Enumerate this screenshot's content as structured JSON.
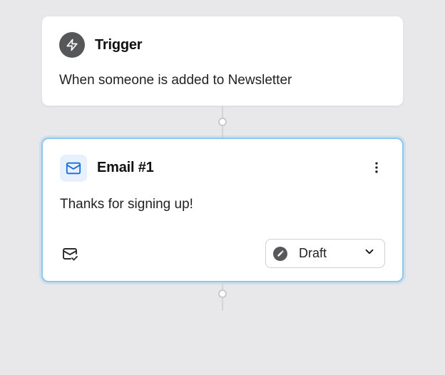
{
  "trigger": {
    "title": "Trigger",
    "description": "When someone is added to Newsletter"
  },
  "email_node": {
    "title": "Email #1",
    "subject": "Thanks for signing up!",
    "status_label": "Draft"
  },
  "icons": {
    "trigger": "lightning-icon",
    "email": "mail-icon",
    "preview": "mail-check-icon",
    "status": "pencil-circle-icon",
    "more": "more-vertical-icon",
    "chevron": "chevron-down-icon"
  },
  "colors": {
    "canvas_bg": "#e8e8ea",
    "selection": "#8fc7ed",
    "icon_dark_bg": "#555759",
    "icon_light_bg": "#e7f1fd",
    "mail_blue": "#1a6cdb"
  }
}
